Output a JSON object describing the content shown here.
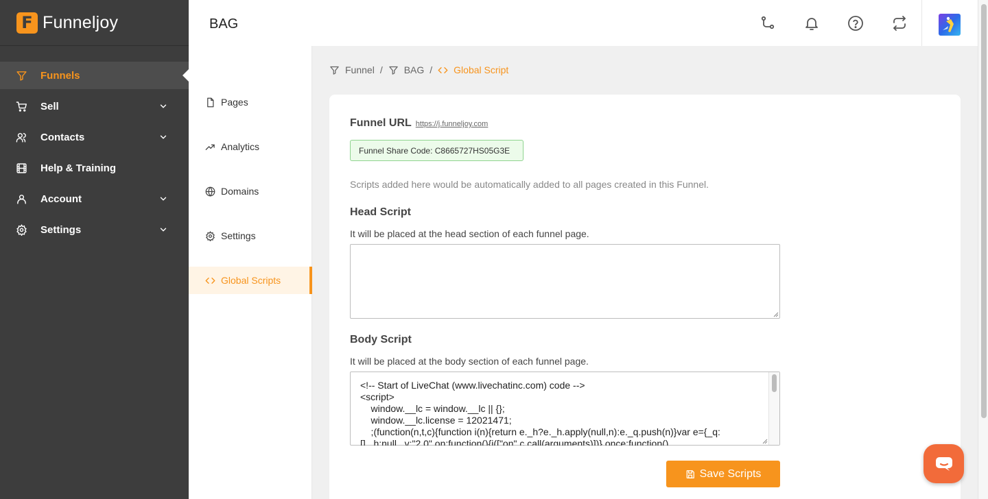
{
  "brand": {
    "logo_letter": "F",
    "name": "Funneljoy"
  },
  "sidebar": {
    "items": [
      {
        "label": "Funnels",
        "icon": "funnel-icon",
        "active": true,
        "has_chevron": false
      },
      {
        "label": "Sell",
        "icon": "cart-icon",
        "active": false,
        "has_chevron": true
      },
      {
        "label": "Contacts",
        "icon": "users-icon",
        "active": false,
        "has_chevron": true
      },
      {
        "label": "Help & Training",
        "icon": "film-icon",
        "active": false,
        "has_chevron": false
      },
      {
        "label": "Account",
        "icon": "user-icon",
        "active": false,
        "has_chevron": true
      },
      {
        "label": "Settings",
        "icon": "gear-icon",
        "active": false,
        "has_chevron": true
      }
    ]
  },
  "header": {
    "title": "BAG",
    "icons": [
      "git-branch-icon",
      "bell-icon",
      "help-circle-icon",
      "sync-icon",
      "avatar"
    ]
  },
  "submenu": {
    "items": [
      {
        "label": "Pages",
        "icon": "file-icon"
      },
      {
        "label": "Analytics",
        "icon": "trend-icon"
      },
      {
        "label": "Domains",
        "icon": "globe-icon"
      },
      {
        "label": "Settings",
        "icon": "gear-icon"
      },
      {
        "label": "Global Scripts",
        "icon": "code-icon",
        "active": true
      }
    ]
  },
  "breadcrumb": {
    "items": [
      "Funnel",
      "BAG",
      "Global Script"
    ],
    "separator": "/"
  },
  "card": {
    "url_label": "Funnel URL",
    "url_link": "https://j.funneljoy.com",
    "share_code": "Funnel Share Code: C8665727HS05G3E",
    "info": "Scripts added here would be automatically added to all pages created in this Funnel.",
    "head": {
      "title": "Head Script",
      "desc": "It will be placed at the head section of each funnel page.",
      "value": ""
    },
    "body": {
      "title": "Body Script",
      "desc": "It will be placed at the body section of each funnel page.",
      "value": "<!-- Start of LiveChat (www.livechatinc.com) code -->\n<script>\n    window.__lc = window.__lc || {};\n    window.__lc.license = 12021471;\n    ;(function(n,t,c){function i(n){return e._h?e._h.apply(null,n):e._q.push(n)}var e={_q:\n[],_h:null,_v:\"2.0\",on:function(){i([\"on\",c.call(arguments)])},once:function()"
    },
    "save_label": "Save Scripts"
  },
  "colors": {
    "accent": "#f7941d",
    "sidebar_bg": "#3d3d3d",
    "chat_bg": "#f26b3a",
    "share_border": "#8fd48f",
    "share_bg": "#ecfbea"
  }
}
